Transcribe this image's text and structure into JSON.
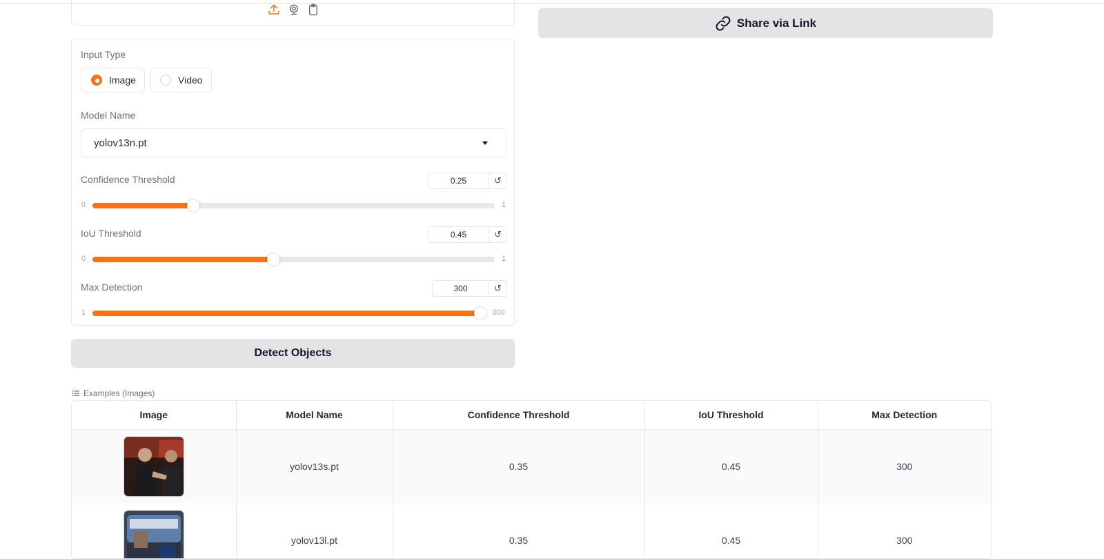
{
  "sources": {
    "icons": [
      "upload-icon",
      "webcam-icon",
      "clipboard-icon"
    ],
    "accent_color": "#f97316"
  },
  "share_button": {
    "label": "Share via Link",
    "icon": "link-icon"
  },
  "input_type": {
    "label": "Input Type",
    "options": [
      "Image",
      "Video"
    ],
    "selected": "Image"
  },
  "model": {
    "label": "Model Name",
    "value": "yolov13n.pt"
  },
  "sliders": {
    "confidence": {
      "label": "Confidence Threshold",
      "value": "0.25",
      "min": "0",
      "max": "1",
      "fraction": 0.25
    },
    "iou": {
      "label": "IoU Threshold",
      "value": "0.45",
      "min": "0",
      "max": "1",
      "fraction": 0.45
    },
    "max_det": {
      "label": "Max Detection",
      "value": "300",
      "min": "1",
      "max": "300",
      "fraction": 1.0
    }
  },
  "detect_button": {
    "label": "Detect Objects"
  },
  "examples": {
    "label": "Examples (Images)",
    "columns": [
      "Image",
      "Model Name",
      "Confidence Threshold",
      "IoU Threshold",
      "Max Detection"
    ],
    "rows": [
      {
        "model": "yolov13s.pt",
        "conf": "0.35",
        "iou": "0.45",
        "max": "300"
      },
      {
        "model": "yolov13l.pt",
        "conf": "0.35",
        "iou": "0.45",
        "max": "300"
      }
    ]
  }
}
